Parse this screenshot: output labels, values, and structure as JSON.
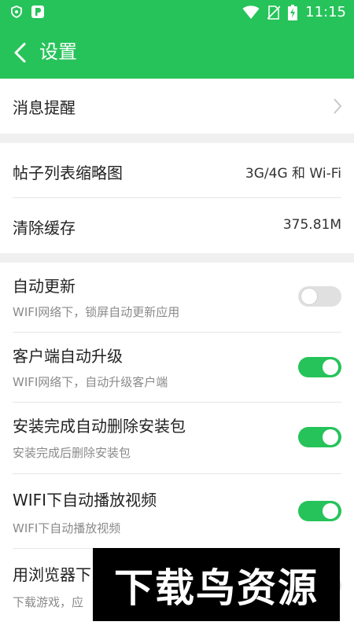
{
  "status_bar": {
    "time": "11:15",
    "icons": [
      "shield-icon",
      "parking-app-icon",
      "wifi-icon",
      "no-sim-icon",
      "battery-charging-icon"
    ]
  },
  "header": {
    "title": "设置",
    "back_icon": "chevron-left-icon"
  },
  "colors": {
    "accent": "#26c35a",
    "background": "#f0f0f0",
    "toggle_off": "#e0e0e0"
  },
  "section1": {
    "message_reminder": "消息提醒"
  },
  "section2": {
    "thumbnail_label": "帖子列表缩略图",
    "thumbnail_value": "3G/4G 和 Wi-Fi",
    "clear_cache_label": "清除缓存",
    "clear_cache_value": "375.81M"
  },
  "section3": {
    "items": [
      {
        "label": "自动更新",
        "desc": "WIFI网络下，锁屏自动更新应用",
        "enabled": false
      },
      {
        "label": "客户端自动升级",
        "desc": "WIFI网络下，自动升级客户端",
        "enabled": true
      },
      {
        "label": "安装完成自动删除安装包",
        "desc": "安装完成后删除安装包",
        "enabled": true
      },
      {
        "label": "WIFI下自动播放视频",
        "desc": "WIFI下自动播放视频",
        "enabled": true
      },
      {
        "label": "用浏览器下",
        "desc": "下载游戏，应",
        "enabled": false
      }
    ]
  },
  "watermark": "下载鸟资源"
}
